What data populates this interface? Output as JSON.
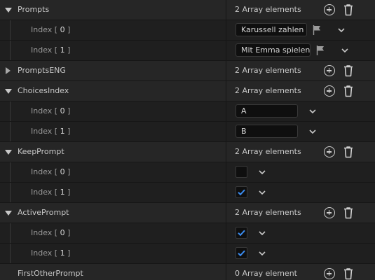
{
  "props": {
    "prompts": {
      "name": "Prompts",
      "count": "2 Array elements",
      "items": [
        {
          "index_prefix": "Index [ ",
          "index": "0",
          "index_suffix": " ]",
          "value": "Karussell zahlen"
        },
        {
          "index_prefix": "Index [ ",
          "index": "1",
          "index_suffix": " ]",
          "value": "Mit Emma spielen"
        }
      ]
    },
    "prompts_eng": {
      "name": "PromptsENG",
      "count": "2 Array elements"
    },
    "choices_index": {
      "name": "ChoicesIndex",
      "count": "2 Array elements",
      "items": [
        {
          "index_prefix": "Index [ ",
          "index": "0",
          "index_suffix": " ]",
          "value": "A"
        },
        {
          "index_prefix": "Index [ ",
          "index": "1",
          "index_suffix": " ]",
          "value": "B"
        }
      ]
    },
    "keep_prompt": {
      "name": "KeepPrompt",
      "count": "2 Array elements",
      "items": [
        {
          "index_prefix": "Index [ ",
          "index": "0",
          "index_suffix": " ]",
          "checked": false
        },
        {
          "index_prefix": "Index [ ",
          "index": "1",
          "index_suffix": " ]",
          "checked": true
        }
      ]
    },
    "active_prompt": {
      "name": "ActivePrompt",
      "count": "2 Array elements",
      "items": [
        {
          "index_prefix": "Index [ ",
          "index": "0",
          "index_suffix": " ]",
          "checked": true
        },
        {
          "index_prefix": "Index [ ",
          "index": "1",
          "index_suffix": " ]",
          "checked": true
        }
      ]
    },
    "first_other_prompt": {
      "name": "FirstOtherPrompt",
      "count": "0 Array element"
    }
  },
  "colors": {
    "accent": "#3b8cf0",
    "checkbox_bg": "#0f0f0f",
    "icon": "#d0d0d0"
  },
  "icons": {
    "expand": "triangle-down-icon",
    "collapse": "triangle-right-icon",
    "add": "plus-circle-icon",
    "delete": "trash-icon",
    "localize": "flag-icon",
    "options": "chevron-down-icon"
  }
}
